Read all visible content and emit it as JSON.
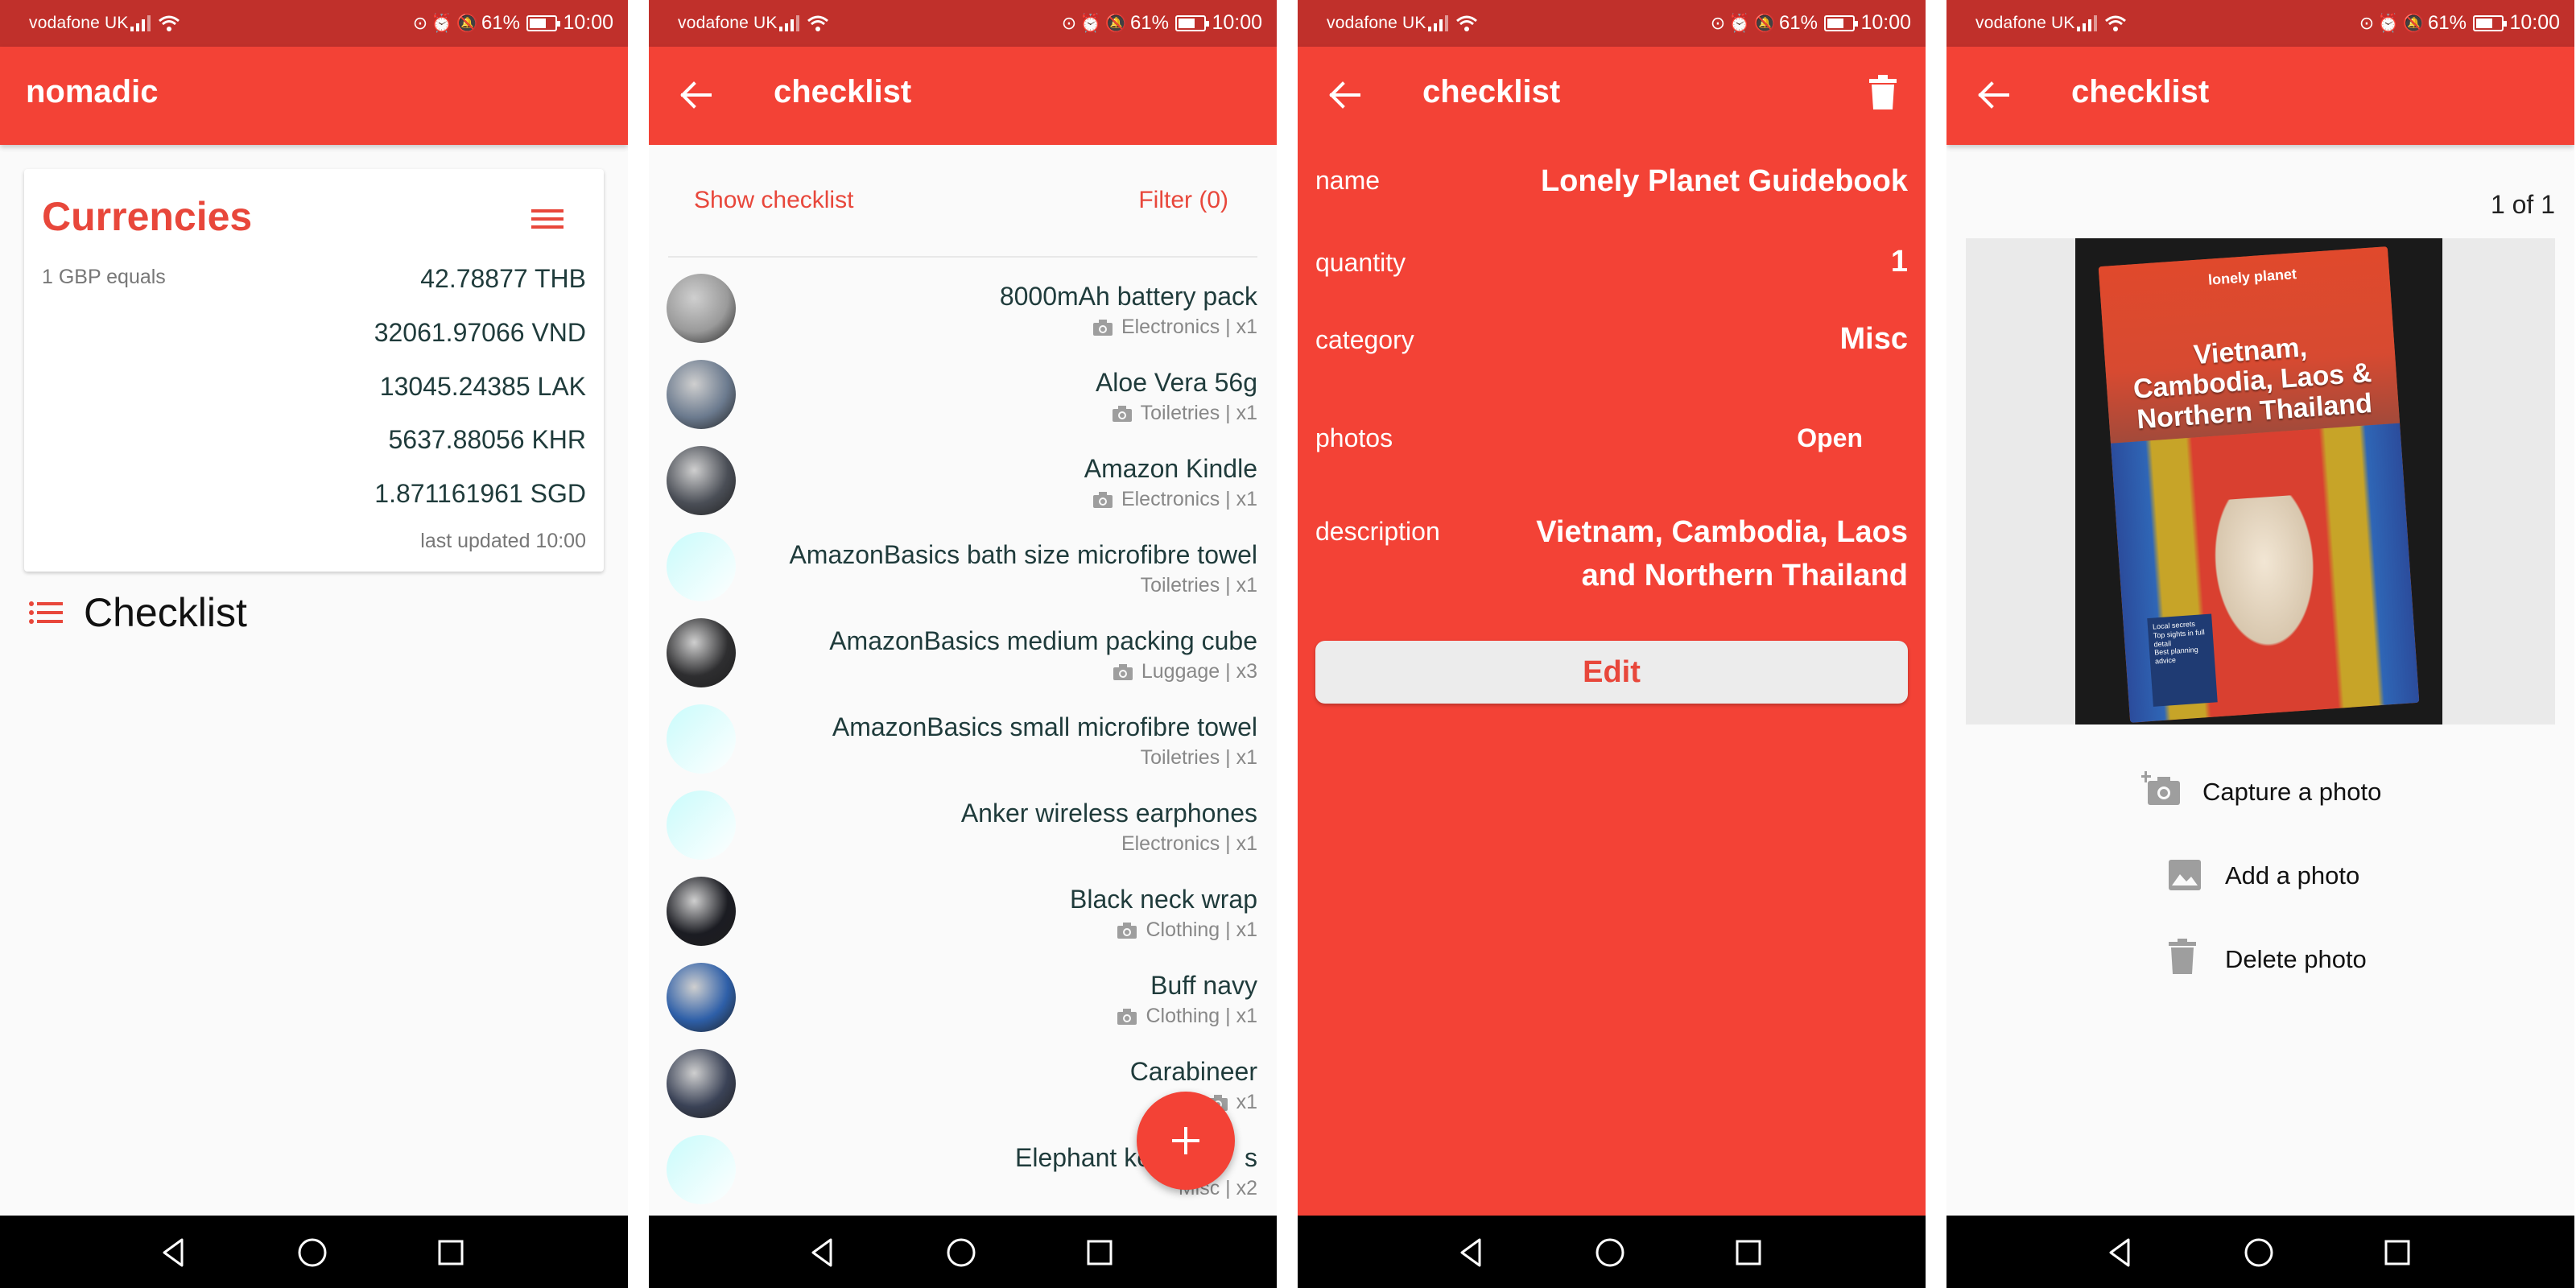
{
  "status_bar": {
    "carrier": "vodafone UK",
    "battery": "61%",
    "time": "10:00"
  },
  "screen1": {
    "app_title": "nomadic",
    "currencies": {
      "title": "Currencies",
      "base_label": "1 GBP equals",
      "rates": [
        "42.78877 THB",
        "32061.97066 VND",
        "13045.24385 LAK",
        "5637.88056 KHR",
        "1.871161961 SGD"
      ],
      "last_updated": "last updated 10:00"
    },
    "checklist_title": "Checklist"
  },
  "screen2": {
    "title": "checklist",
    "show_checklist": "Show checklist",
    "filter": "Filter (0)",
    "items": [
      {
        "name": "8000mAh battery pack",
        "sub": "Electronics | x1",
        "photo": true,
        "thumb": "#9a9a9a"
      },
      {
        "name": "Aloe Vera 56g",
        "sub": "Toiletries | x1",
        "photo": true,
        "thumb": "#6b7a8e"
      },
      {
        "name": "Amazon Kindle",
        "sub": "Electronics | x1",
        "photo": true,
        "thumb": "#4a4e56"
      },
      {
        "name": "AmazonBasics bath size microfibre towel",
        "sub": "Toiletries | x1",
        "photo": false,
        "thumb": ""
      },
      {
        "name": "AmazonBasics medium packing cube",
        "sub": "Luggage | x3",
        "photo": true,
        "thumb": "#2e2e30"
      },
      {
        "name": "AmazonBasics small microfibre towel",
        "sub": "Toiletries | x1",
        "photo": false,
        "thumb": ""
      },
      {
        "name": "Anker wireless earphones",
        "sub": "Electronics | x1",
        "photo": false,
        "thumb": ""
      },
      {
        "name": "Black neck wrap",
        "sub": "Clothing | x1",
        "photo": true,
        "thumb": "#1b1c22"
      },
      {
        "name": "Buff navy",
        "sub": "Clothing | x1",
        "photo": true,
        "thumb": "#2e5fa8"
      },
      {
        "name": "Carabineer",
        "sub": "x1",
        "photo": true,
        "thumb": "#3a4256"
      },
      {
        "name": "Elephant ke",
        "name_end": "s",
        "sub": "Misc | x2",
        "photo": false,
        "thumb": ""
      }
    ]
  },
  "screen3": {
    "title": "checklist",
    "fields": {
      "name_label": "name",
      "name_value": "Lonely Planet Guidebook",
      "quantity_label": "quantity",
      "quantity_value": "1",
      "category_label": "category",
      "category_value": "Misc",
      "photos_label": "photos",
      "photos_value": "Open",
      "description_label": "description",
      "description_line1": "Vietnam, Cambodia, Laos",
      "description_line2": "and Northern Thailand"
    },
    "edit_label": "Edit"
  },
  "screen4": {
    "title": "checklist",
    "counter": "1 of 1",
    "cover": {
      "brand": "lonely planet",
      "title_line1": "Vietnam,",
      "title_line2": "Cambodia, Laos &",
      "title_line3": "Northern Thailand",
      "badge_line1": "Local secrets",
      "badge_line2": "Top sights in full detail",
      "badge_line3": "Best planning advice"
    },
    "actions": {
      "capture": "Capture a photo",
      "add": "Add a photo",
      "delete": "Delete photo"
    }
  },
  "colors": {
    "primary": "#f34236",
    "status": "#c0302b",
    "accent_text": "#e8473b"
  }
}
